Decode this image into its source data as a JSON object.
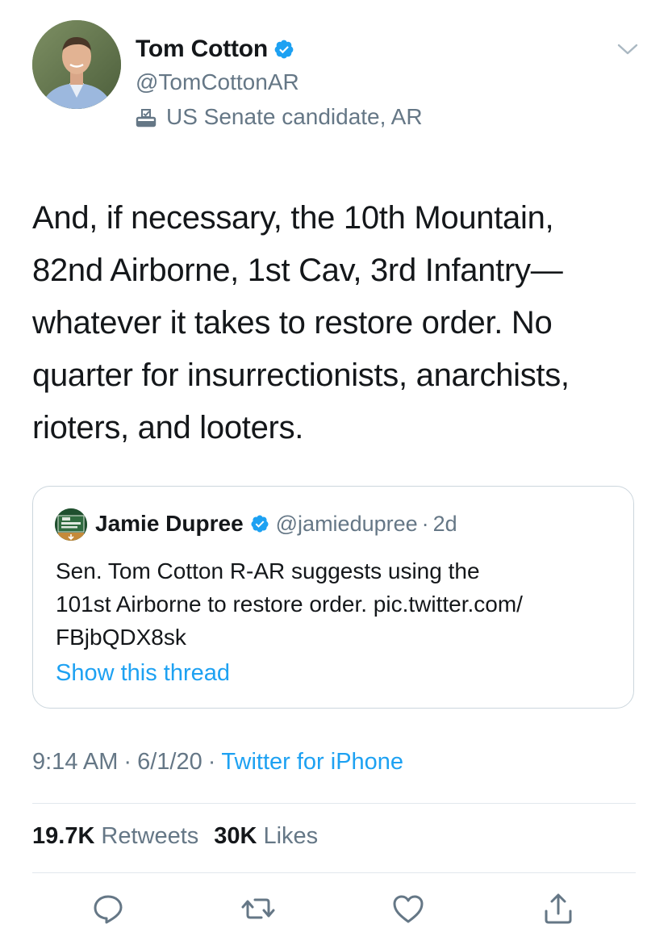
{
  "author": {
    "name": "Tom Cotton",
    "handle": "@TomCottonAR",
    "label": "US Senate candidate, AR",
    "avatar_icon": "profile-photo",
    "verified_icon": "verified-badge-icon"
  },
  "tweet": {
    "lines": [
      "And, if necessary, the 10th Mountain,",
      "82nd Airborne, 1st Cav, 3rd Infantry—",
      "whatever it takes to restore order. No",
      "quarter for insurrectionists, anarchists,",
      "rioters, and looters."
    ]
  },
  "quoted_tweet": {
    "name": "Jamie Dupree",
    "handle": "@jamiedupree",
    "separator": "·",
    "time": "2d",
    "lines": [
      "Sen. Tom Cotton R-AR suggests using the",
      "101st Airborne to restore order. pic.twitter.com/",
      "FBjbQDX8sk"
    ],
    "show_thread": "Show this thread"
  },
  "meta": {
    "time": "9:14 AM",
    "sep": "·",
    "date": "6/1/20",
    "source": "Twitter for iPhone"
  },
  "stats": {
    "retweets_count": "19.7K",
    "retweets_label": "Retweets",
    "likes_count": "30K",
    "likes_label": "Likes"
  },
  "actions": [
    "reply-icon",
    "retweet-icon",
    "like-icon",
    "share-icon"
  ],
  "colors": {
    "text": "#14171a",
    "secondary": "#657786",
    "accent": "#1da1f2",
    "border": "#ccd6dd"
  }
}
